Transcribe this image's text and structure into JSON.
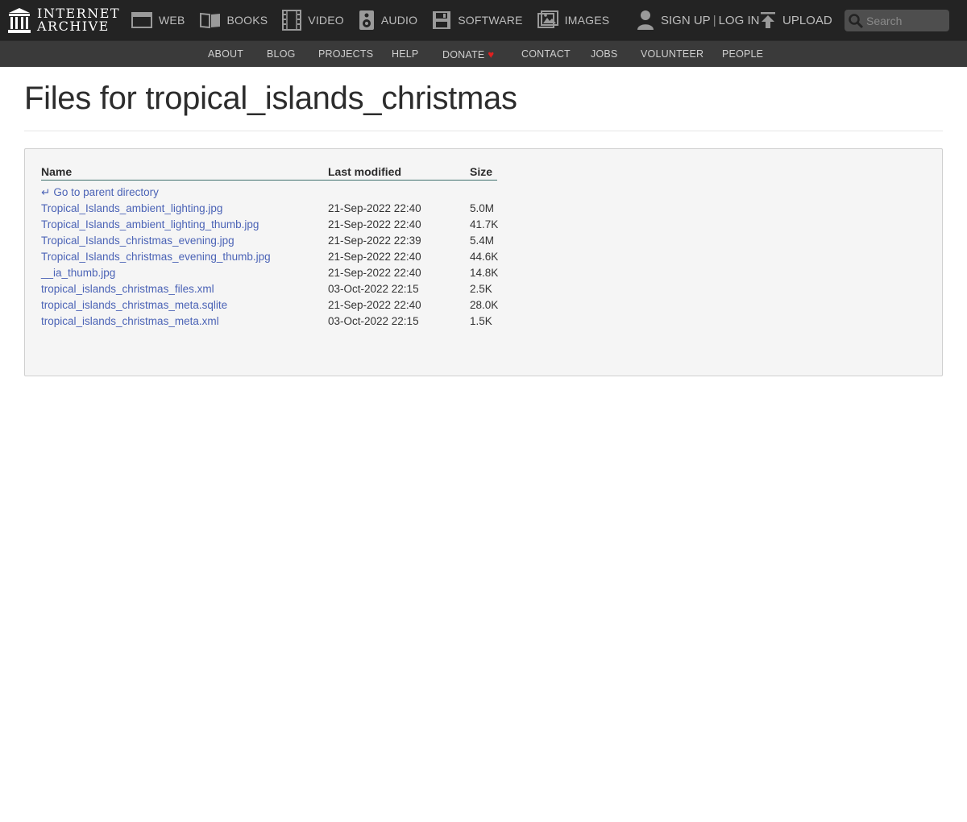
{
  "logo": {
    "line1": "INTERNET",
    "line2": "ARCHIVE"
  },
  "media_nav": [
    {
      "label": "WEB",
      "icon": "web-icon"
    },
    {
      "label": "BOOKS",
      "icon": "books-icon"
    },
    {
      "label": "VIDEO",
      "icon": "film-icon"
    },
    {
      "label": "AUDIO",
      "icon": "speaker-icon"
    },
    {
      "label": "SOFTWARE",
      "icon": "floppy-disk-icon"
    },
    {
      "label": "IMAGES",
      "icon": "images-icon"
    }
  ],
  "user": {
    "signup": "SIGN UP",
    "separator": "|",
    "login": "LOG IN",
    "upload": "UPLOAD"
  },
  "search": {
    "placeholder": "Search"
  },
  "subnav": [
    "ABOUT",
    "BLOG",
    "PROJECTS",
    "HELP",
    "DONATE",
    "CONTACT",
    "JOBS",
    "VOLUNTEER",
    "PEOPLE"
  ],
  "page": {
    "title": "Files for tropical_islands_christmas"
  },
  "table": {
    "headers": {
      "name": "Name",
      "modified": "Last modified",
      "size": "Size"
    },
    "parent_link": "Go to parent directory",
    "rows": [
      {
        "name": "Tropical_Islands_ambient_lighting.jpg",
        "modified": "21-Sep-2022 22:40",
        "size": "5.0M"
      },
      {
        "name": "Tropical_Islands_ambient_lighting_thumb.jpg",
        "modified": "21-Sep-2022 22:40",
        "size": "41.7K"
      },
      {
        "name": "Tropical_Islands_christmas_evening.jpg",
        "modified": "21-Sep-2022 22:39",
        "size": "5.4M"
      },
      {
        "name": "Tropical_Islands_christmas_evening_thumb.jpg",
        "modified": "21-Sep-2022 22:40",
        "size": "44.6K"
      },
      {
        "name": "__ia_thumb.jpg",
        "modified": "21-Sep-2022 22:40",
        "size": "14.8K"
      },
      {
        "name": "tropical_islands_christmas_files.xml",
        "modified": "03-Oct-2022 22:15",
        "size": "2.5K"
      },
      {
        "name": "tropical_islands_christmas_meta.sqlite",
        "modified": "21-Sep-2022 22:40",
        "size": "28.0K"
      },
      {
        "name": "tropical_islands_christmas_meta.xml",
        "modified": "03-Oct-2022 22:15",
        "size": "1.5K"
      }
    ]
  },
  "colors": {
    "topbar": "#232323",
    "subnav": "#3a3a3a",
    "link": "#4b63b6",
    "heart": "#e02020"
  }
}
